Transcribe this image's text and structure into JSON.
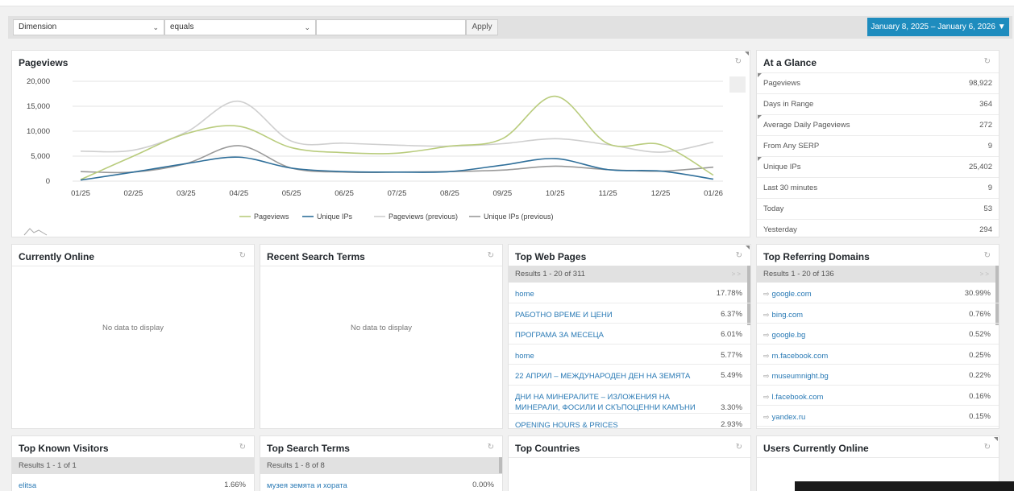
{
  "filter": {
    "dimension": "Dimension",
    "operator": "equals",
    "value": "",
    "apply": "Apply",
    "date_range": "January 8, 2025 – January 6, 2026"
  },
  "pageviews": {
    "title": "Pageviews",
    "chart_data": {
      "type": "line",
      "categories": [
        "01/25",
        "02/25",
        "03/25",
        "04/25",
        "05/25",
        "06/25",
        "07/25",
        "08/25",
        "09/25",
        "10/25",
        "11/25",
        "12/25",
        "01/26"
      ],
      "ylim": [
        0,
        20000
      ],
      "yticks": [
        "20,000",
        "15,000",
        "10,000",
        "5,000",
        "0"
      ],
      "series": [
        {
          "name": "Pageviews",
          "color": "#b9cc7d",
          "values": [
            300,
            5000,
            9500,
            11000,
            6700,
            5700,
            5600,
            7000,
            8500,
            17000,
            7500,
            7300,
            1200
          ]
        },
        {
          "name": "Unique IPs",
          "color": "#2f6f9a",
          "values": [
            200,
            1800,
            3500,
            4800,
            2600,
            1900,
            1800,
            1900,
            3200,
            4500,
            2300,
            2000,
            400
          ]
        },
        {
          "name": "Pageviews (previous)",
          "color": "#cfcfcf",
          "values": [
            6000,
            6200,
            9800,
            16000,
            8000,
            7600,
            7200,
            7000,
            7500,
            8500,
            7300,
            5800,
            7800
          ]
        },
        {
          "name": "Unique IPs (previous)",
          "color": "#9a9a9a",
          "values": [
            1900,
            1800,
            3500,
            7100,
            2600,
            1800,
            1800,
            1900,
            2200,
            3000,
            2300,
            2000,
            2800
          ]
        }
      ]
    }
  },
  "glance": {
    "title": "At a Glance",
    "rows": [
      {
        "label": "Pageviews",
        "value": "98,922"
      },
      {
        "label": "Days in Range",
        "value": "364"
      },
      {
        "label": "Average Daily Pageviews",
        "value": "272"
      },
      {
        "label": "From Any SERP",
        "value": "9"
      },
      {
        "label": "Unique IPs",
        "value": "25,402"
      },
      {
        "label": "Last 30 minutes",
        "value": "9"
      },
      {
        "label": "Today",
        "value": "53"
      },
      {
        "label": "Yesterday",
        "value": "294"
      }
    ]
  },
  "currently_online": {
    "title": "Currently Online",
    "empty": "No data to display"
  },
  "recent_search": {
    "title": "Recent Search Terms",
    "empty": "No data to display"
  },
  "top_pages": {
    "title": "Top Web Pages",
    "results": "Results 1 - 20 of 311",
    "rows": [
      {
        "text": "home",
        "pct": "17.78%"
      },
      {
        "text": "РАБОТНО ВРЕМЕ И ЦЕНИ",
        "pct": "6.37%"
      },
      {
        "text": "ПРОГРАМА ЗА МЕСЕЦА",
        "pct": "6.01%"
      },
      {
        "text": "home",
        "pct": "5.77%"
      },
      {
        "text": "22 АПРИЛ – МЕЖДУНАРОДЕН ДЕН НА ЗЕМЯТА",
        "pct": "5.49%"
      },
      {
        "text": "ДНИ НА МИНЕРАЛИТЕ – ИЗЛОЖЕНИЯ НА МИНЕРАЛИ, ФОСИЛИ И СКЪПОЦЕННИ КАМЪНИ",
        "pct": "3.30%"
      },
      {
        "text": "OPENING HOURS & PRICES",
        "pct": "2.93%"
      }
    ]
  },
  "top_domains": {
    "title": "Top Referring Domains",
    "results": "Results 1 - 20 of 136",
    "rows": [
      {
        "text": "google.com",
        "pct": "30.99%"
      },
      {
        "text": "bing.com",
        "pct": "0.76%"
      },
      {
        "text": "google.bg",
        "pct": "0.52%"
      },
      {
        "text": "m.facebook.com",
        "pct": "0.25%"
      },
      {
        "text": "museumnight.bg",
        "pct": "0.22%"
      },
      {
        "text": "l.facebook.com",
        "pct": "0.16%"
      },
      {
        "text": "yandex.ru",
        "pct": "0.15%"
      }
    ]
  },
  "known_visitors": {
    "title": "Top Known Visitors",
    "results": "Results 1 - 1 of 1",
    "rows": [
      {
        "text": "elitsa",
        "pct": "1.66%"
      }
    ]
  },
  "search_terms": {
    "title": "Top Search Terms",
    "results": "Results 1 - 8 of 8",
    "rows": [
      {
        "text": "музея земята и хората",
        "pct": "0.00%"
      }
    ]
  },
  "countries": {
    "title": "Top Countries"
  },
  "users_online": {
    "title": "Users Currently Online"
  }
}
